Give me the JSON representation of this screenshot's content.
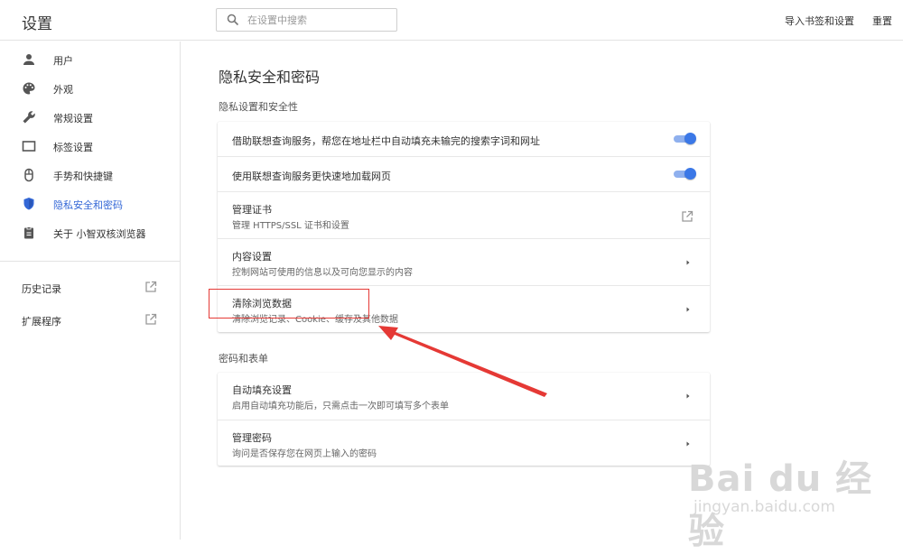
{
  "header": {
    "title": "设置",
    "search_placeholder": "在设置中搜索",
    "import_label": "导入书签和设置",
    "reset_label": "重置"
  },
  "sidebar": {
    "items": [
      {
        "label": "用户",
        "icon": "person-icon"
      },
      {
        "label": "外观",
        "icon": "palette-icon"
      },
      {
        "label": "常规设置",
        "icon": "wrench-icon"
      },
      {
        "label": "标签设置",
        "icon": "tab-icon"
      },
      {
        "label": "手势和快捷键",
        "icon": "mouse-icon"
      },
      {
        "label": "隐私安全和密码",
        "icon": "shield-icon",
        "active": true
      },
      {
        "label": "关于 小智双核浏览器",
        "icon": "clipboard-icon"
      }
    ],
    "links": [
      {
        "label": "历史记录",
        "icon": "external-link-icon"
      },
      {
        "label": "扩展程序",
        "icon": "external-link-icon"
      }
    ]
  },
  "main": {
    "page_title": "隐私安全和密码",
    "privacy_section": {
      "title": "隐私设置和安全性",
      "rows": [
        {
          "primary": "借助联想查询服务，帮您在地址栏中自动填充未输完的搜索字词和网址",
          "control": "toggle",
          "on": true
        },
        {
          "primary": "使用联想查询服务更快速地加载网页",
          "control": "toggle",
          "on": true
        },
        {
          "primary": "管理证书",
          "secondary": "管理 HTTPS/SSL 证书和设置",
          "control": "external-link"
        },
        {
          "primary": "内容设置",
          "secondary": "控制网站可使用的信息以及可向您显示的内容",
          "control": "arrow"
        },
        {
          "primary": "清除浏览数据",
          "secondary": "清除浏览记录、Cookie、缓存及其他数据",
          "control": "arrow"
        }
      ]
    },
    "password_section": {
      "title": "密码和表单",
      "rows": [
        {
          "primary": "自动填充设置",
          "secondary": "启用自动填充功能后，只需点击一次即可填写多个表单",
          "control": "arrow"
        },
        {
          "primary": "管理密码",
          "secondary": "询问是否保存您在网页上输入的密码",
          "control": "arrow"
        }
      ]
    }
  },
  "watermark": {
    "logo_text": "Bai du 经验",
    "url": "jingyan.baidu.com"
  },
  "colors": {
    "accent": "#3367d6",
    "toggle_knob": "#3b78e7",
    "annotation": "#e53935"
  }
}
